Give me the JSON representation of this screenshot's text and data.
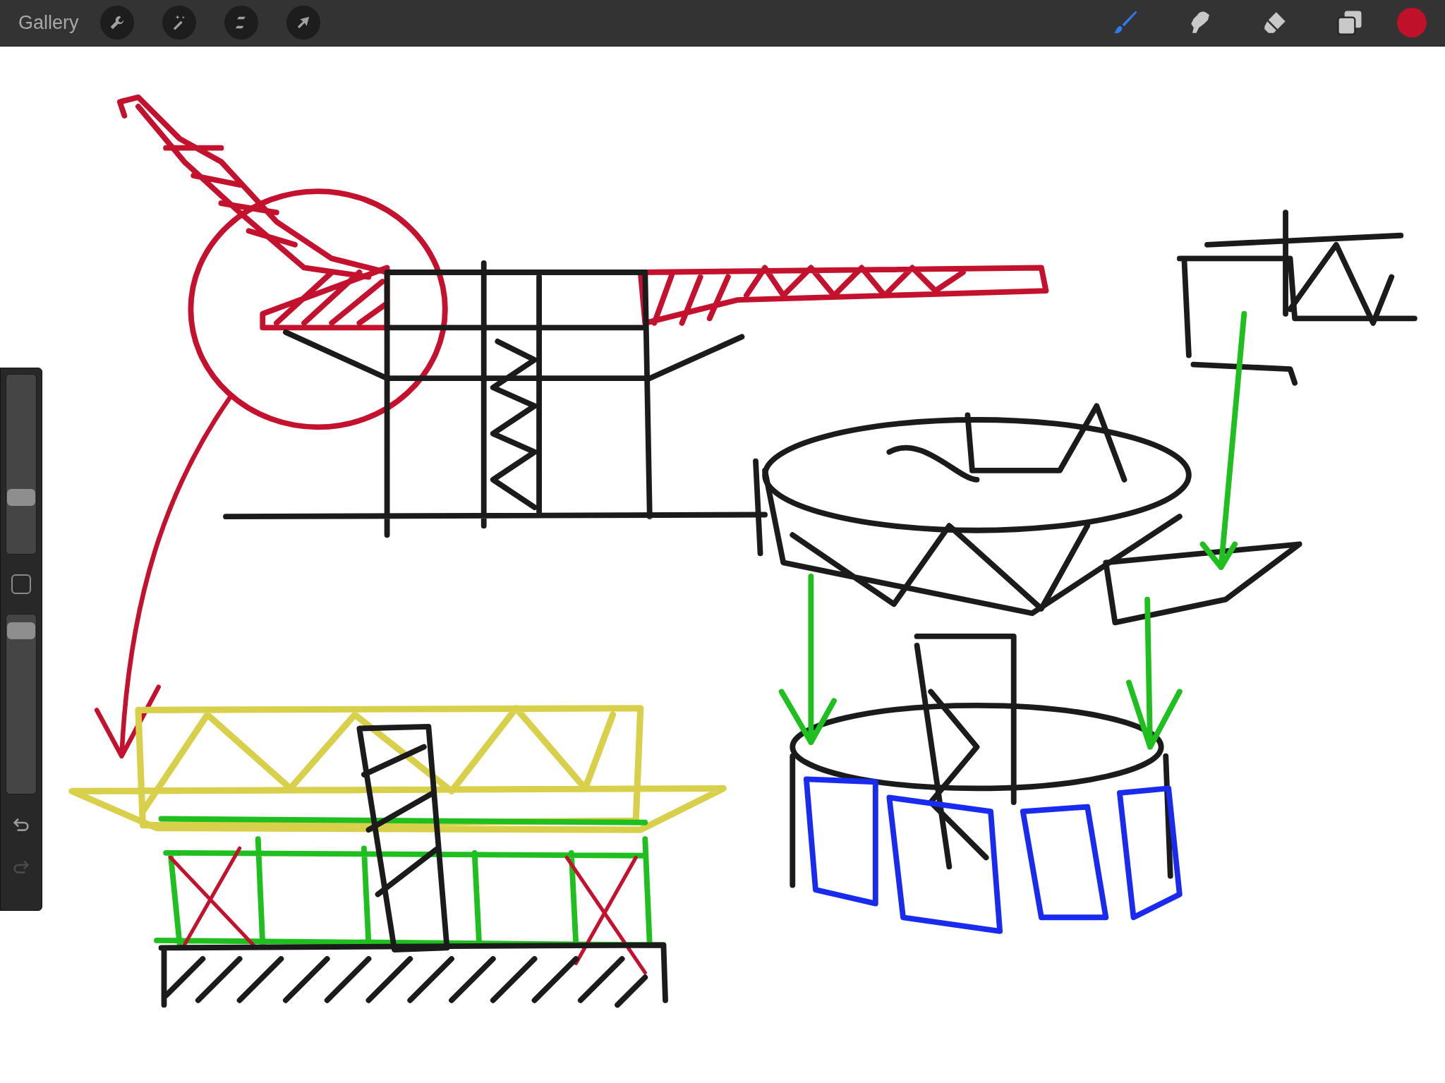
{
  "toolbar": {
    "gallery": "Gallery",
    "actions": [
      {
        "kind": "wrench"
      },
      {
        "kind": "wand"
      },
      {
        "kind": "selection"
      },
      {
        "kind": "move"
      }
    ],
    "tools": [
      {
        "kind": "brush",
        "selected": true
      },
      {
        "kind": "smudge",
        "selected": false
      },
      {
        "kind": "eraser",
        "selected": false
      },
      {
        "kind": "layers",
        "selected": false
      }
    ],
    "color": "#c0112a"
  },
  "sidebar": {
    "size_slider": {
      "level": 0.3
    },
    "opacity_slider": {
      "level": 0.95
    },
    "undo": {
      "disabled": false
    },
    "redo": {
      "disabled": true
    }
  }
}
